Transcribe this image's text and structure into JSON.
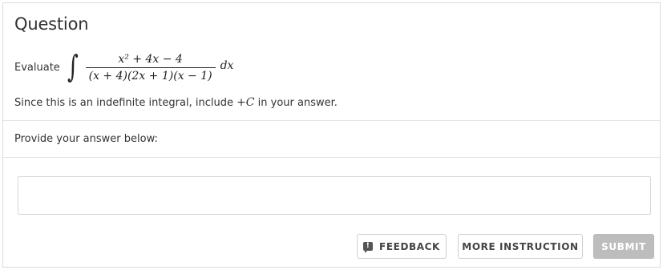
{
  "question": {
    "title": "Question",
    "evaluate_label": "Evaluate",
    "integral": {
      "symbol": "∫",
      "numerator": "x² + 4x − 4",
      "denominator": "(x + 4)(2x + 1)(x − 1)",
      "differential": "dx"
    },
    "note_before": "Since this is an indefinite integral, include ",
    "note_math": "+C",
    "note_after": " in your answer."
  },
  "answer": {
    "prompt": "Provide your answer below:",
    "value": "",
    "placeholder": ""
  },
  "buttons": {
    "feedback_icon": "!",
    "feedback_label": "FEEDBACK",
    "instruction_label": "MORE INSTRUCTION",
    "submit_label": "SUBMIT"
  },
  "colors": {
    "submit_bg": "#bdbdbd",
    "border": "#dcdcdc",
    "text": "#333333"
  }
}
